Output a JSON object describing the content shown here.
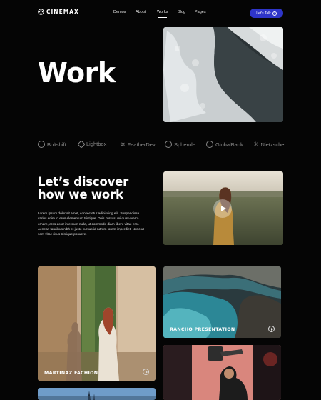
{
  "brand": {
    "name": "CINEMAX"
  },
  "nav": {
    "items": [
      {
        "label": "Demos"
      },
      {
        "label": "About"
      },
      {
        "label": "Works"
      },
      {
        "label": "Blog"
      },
      {
        "label": "Pages"
      }
    ],
    "active": "Works",
    "cta_label": "Let's Talk",
    "cta_color": "#2e35c9"
  },
  "hero": {
    "title": "Work"
  },
  "partners": [
    {
      "name": "Boltshift"
    },
    {
      "name": "Lightbox"
    },
    {
      "name": "FeatherDev"
    },
    {
      "name": "Spherule"
    },
    {
      "name": "GlobalBank"
    },
    {
      "name": "Nietzsche"
    }
  ],
  "discover": {
    "title_line1": "Let’s discover",
    "title_line2": "how we work",
    "body": "Lorem ipsum dolor sit amet, consectetur adipiscing elit. Suspendisse varius enim in eros elementum tristique. Duis cursus, mi quis viverra ornare, eros dolor interdum nulla, ut commodo diam libero vitae erat. Aenean faucibus nibh et justo cursus id rutrum lorem imperdiet. Nunc ut sem vitae risus tristique posuere."
  },
  "projects": [
    {
      "title": "MARTINAZ FACHION"
    },
    {
      "title": "RANCHO PRESENTATION"
    }
  ]
}
